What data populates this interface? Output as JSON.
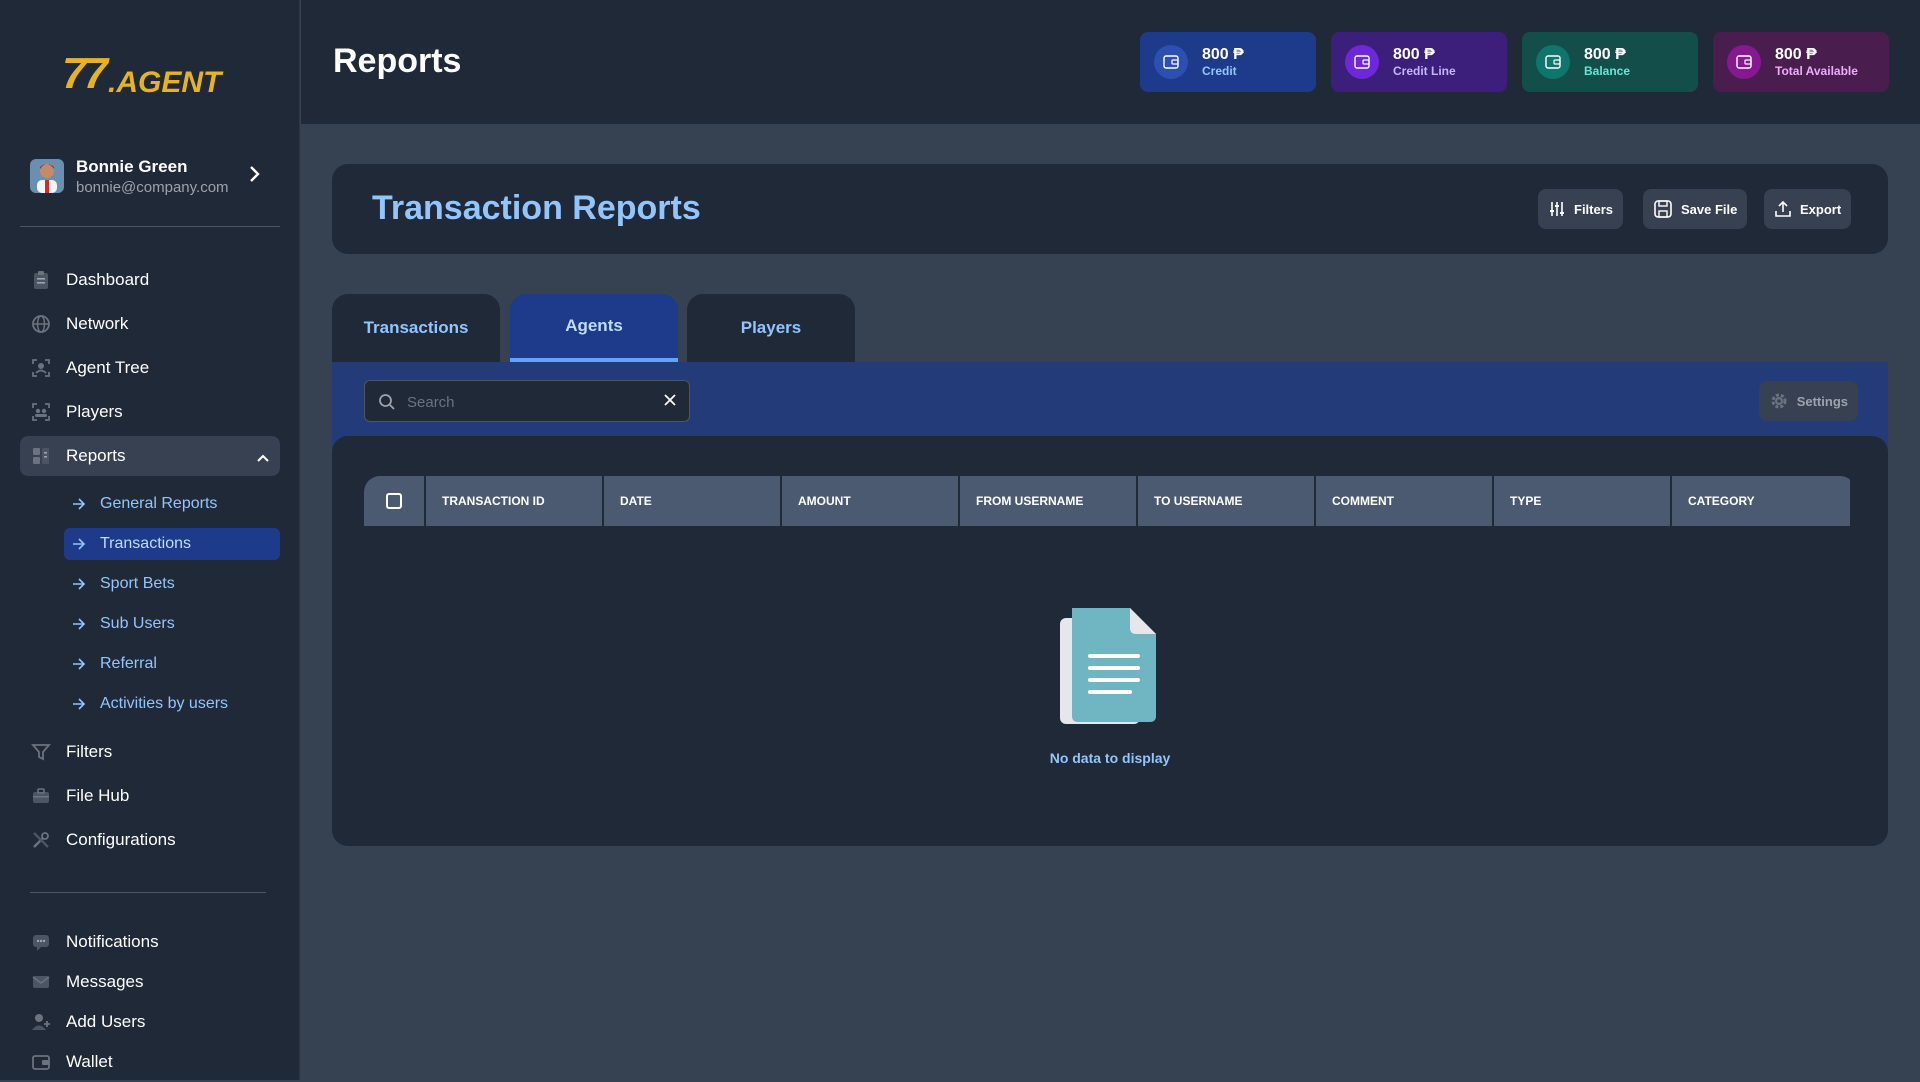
{
  "brand": {
    "logo_text": "77.AGENT",
    "color": "#e6b422"
  },
  "user": {
    "name": "Bonnie Green",
    "email": "bonnie@company.com"
  },
  "sidebar": {
    "items": [
      {
        "label": "Dashboard",
        "icon": "clipboard-icon"
      },
      {
        "label": "Network",
        "icon": "globe-icon"
      },
      {
        "label": "Agent Tree",
        "icon": "scan-user-icon"
      },
      {
        "label": "Players",
        "icon": "players-icon"
      },
      {
        "label": "Reports",
        "icon": "reports-icon",
        "expanded": true
      }
    ],
    "sub_items": [
      {
        "label": "General Reports"
      },
      {
        "label": "Transactions",
        "active": true
      },
      {
        "label": "Sport Bets"
      },
      {
        "label": "Sub Users"
      },
      {
        "label": "Referral"
      },
      {
        "label": "Activities by users"
      }
    ],
    "items_after": [
      {
        "label": "Filters",
        "icon": "filter-icon"
      },
      {
        "label": "File Hub",
        "icon": "briefcase-icon"
      },
      {
        "label": "Configurations",
        "icon": "tools-icon"
      }
    ],
    "items_bottom": [
      {
        "label": "Notifications",
        "icon": "chat-icon"
      },
      {
        "label": "Messages",
        "icon": "envelope-icon"
      },
      {
        "label": "Add Users",
        "icon": "user-plus-icon"
      },
      {
        "label": "Wallet",
        "icon": "wallet-icon"
      }
    ]
  },
  "header": {
    "title": "Reports",
    "stats": [
      {
        "value": "800 ₱",
        "label": "Credit",
        "bg": "#1e3a8a",
        "icon_bg": "#2d4fb0",
        "label_color": "#93c5fd"
      },
      {
        "value": "800 ₱",
        "label": "Credit Line",
        "bg": "#3b1f7a",
        "icon_bg": "#6d28d9",
        "label_color": "#c4b5fd"
      },
      {
        "value": "800 ₱",
        "label": "Balance",
        "bg": "#134e4a",
        "icon_bg": "#0f766e",
        "label_color": "#5eead4"
      },
      {
        "value": "800 ₱",
        "label": "Total Available",
        "bg": "#4a1d4f",
        "icon_bg": "#86198f",
        "label_color": "#f0abfc"
      }
    ]
  },
  "report": {
    "title": "Transaction Reports",
    "buttons": {
      "filters": "Filters",
      "save": "Save File",
      "export": "Export"
    },
    "tabs": [
      {
        "label": "Transactions"
      },
      {
        "label": "Agents",
        "active": true
      },
      {
        "label": "Players"
      }
    ],
    "search": {
      "placeholder": "Search",
      "value": ""
    },
    "settings_label": "Settings",
    "columns": [
      "TRANSACTION ID",
      "DATE",
      "AMOUNT",
      "FROM USERNAME",
      "TO USERNAME",
      "COMMENT",
      "TYPE",
      "CATEGORY"
    ],
    "empty_text": "No data to display"
  }
}
